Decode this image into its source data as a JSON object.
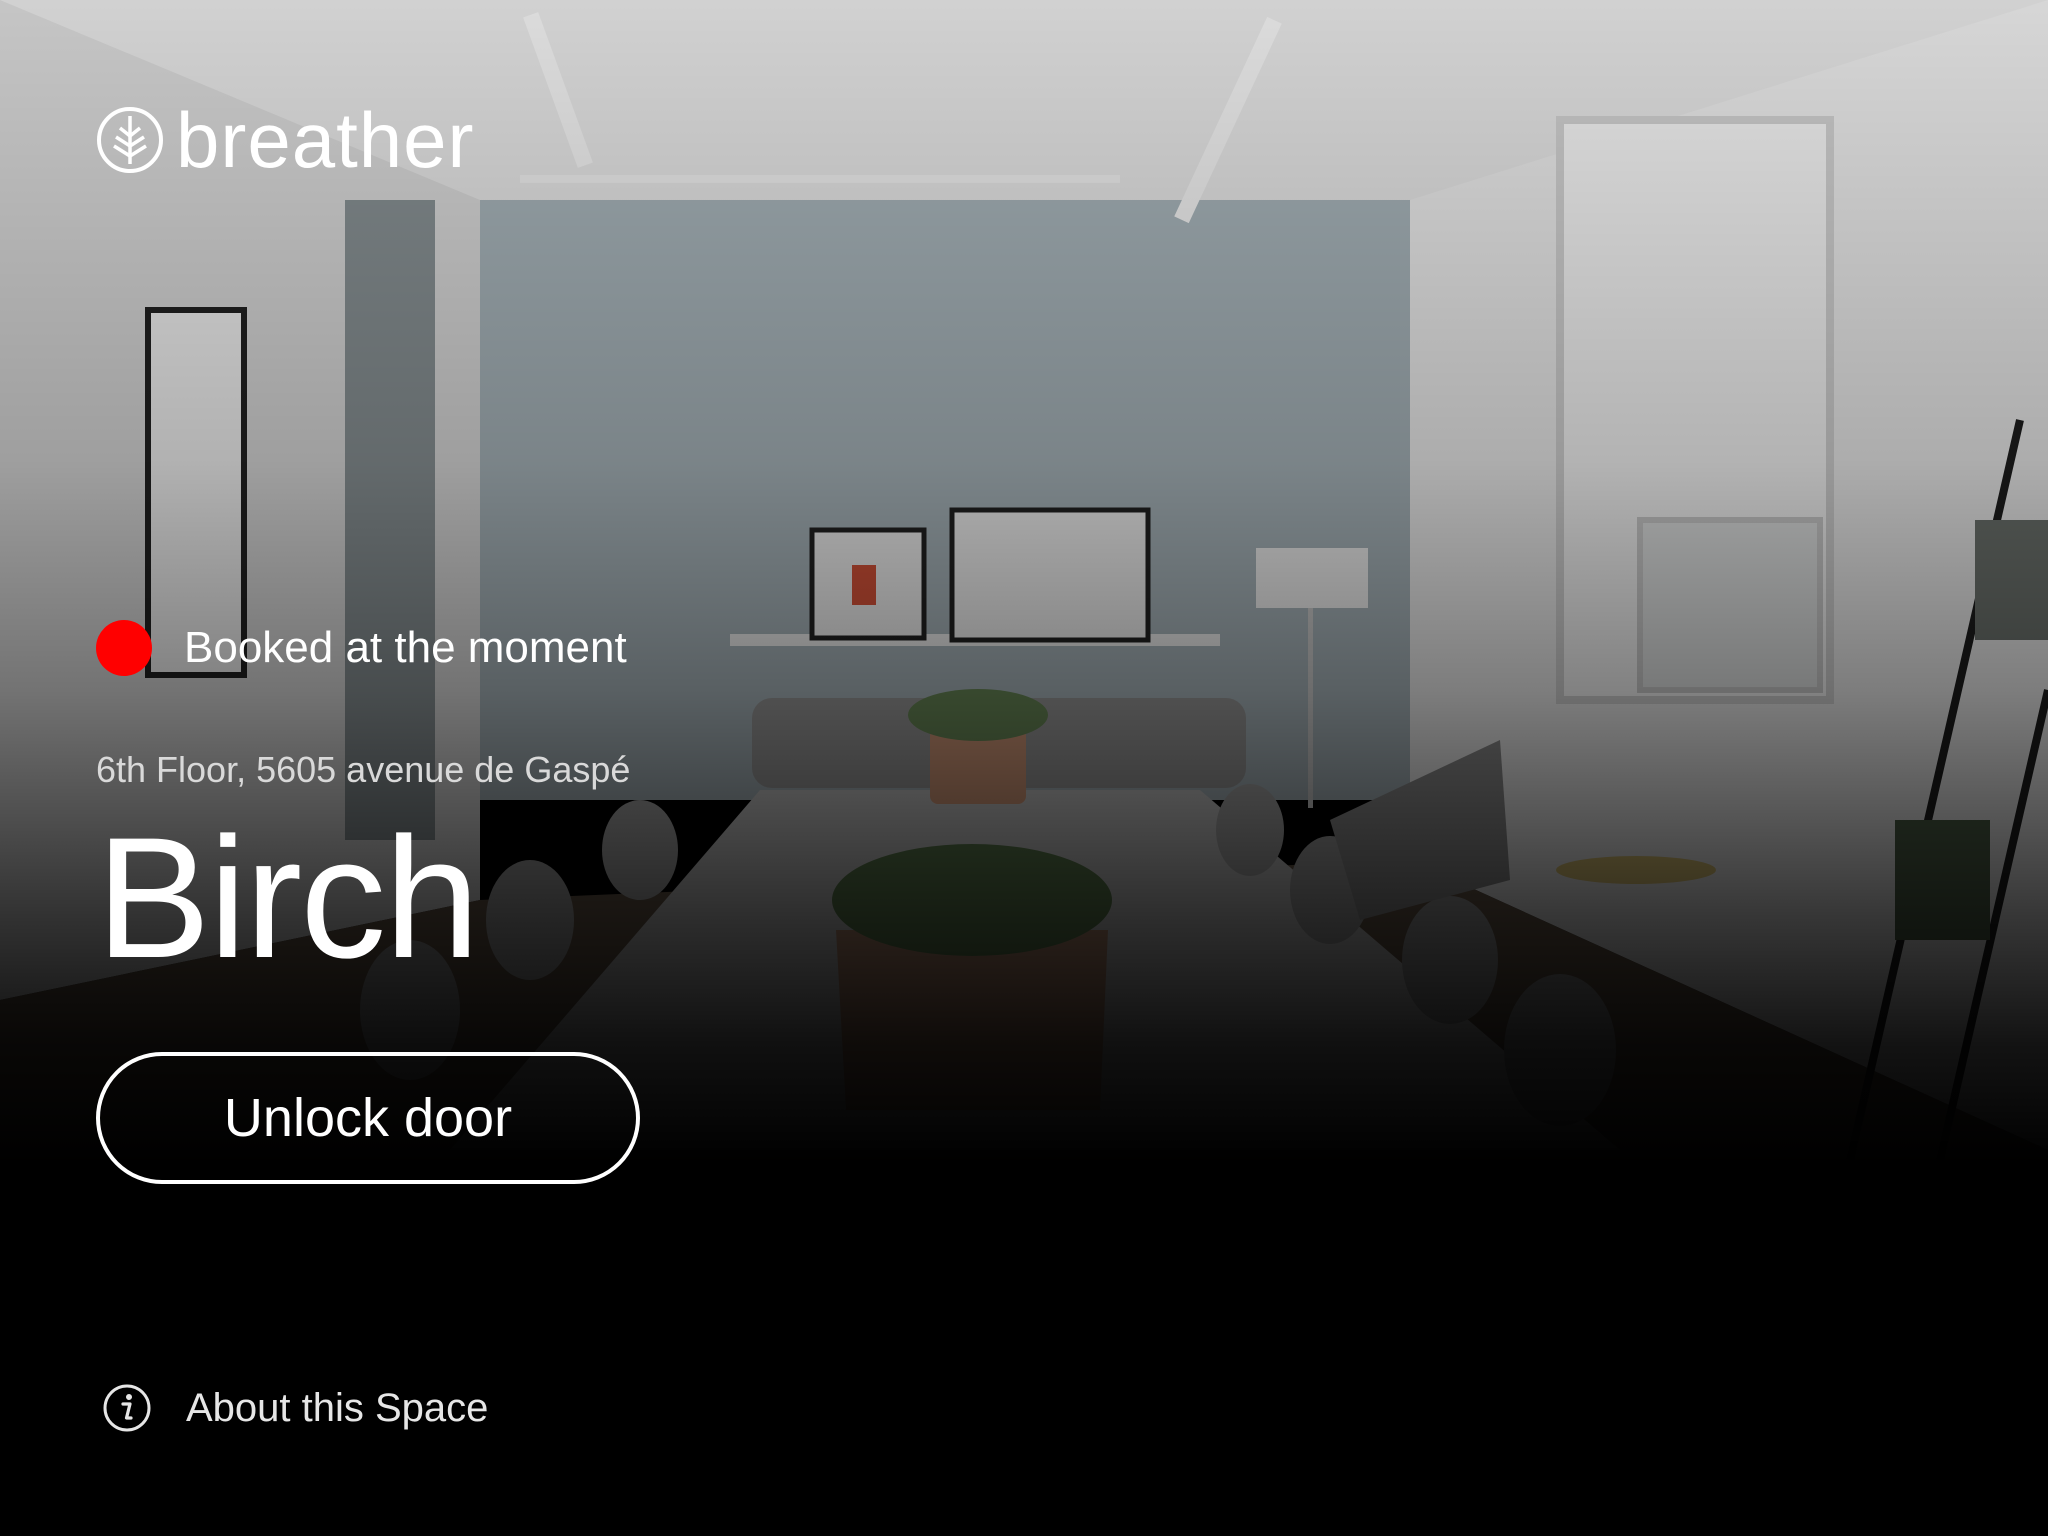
{
  "app": {
    "brand_name": "breather",
    "logo_icon": "tree-ring-icon"
  },
  "space": {
    "status_text": "Booked at the moment",
    "status_color": "#ff0000",
    "address": "6th Floor, 5605 avenue de Gaspé",
    "name": "Birch"
  },
  "actions": {
    "unlock_label": "Unlock door",
    "about_label": "About this Space",
    "about_icon": "info-icon"
  },
  "background": {
    "subject": "meeting-room-photo"
  }
}
